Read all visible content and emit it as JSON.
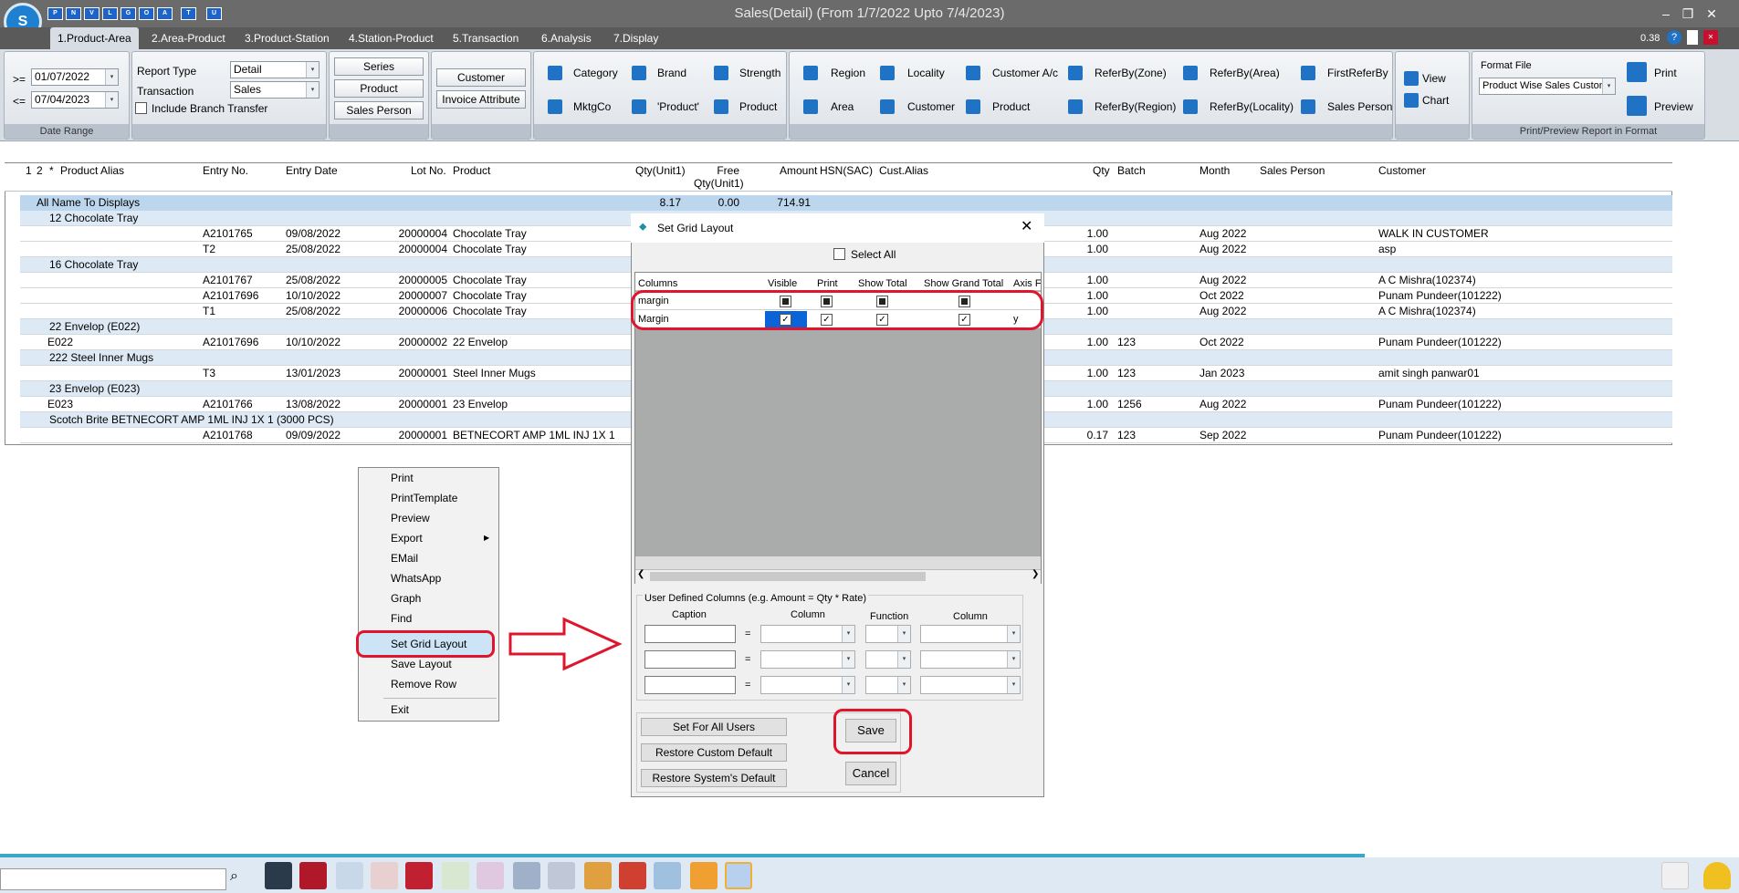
{
  "window": {
    "title": "Sales(Detail) (From 1/7/2022 Upto 7/4/2023)",
    "zoom": "0.38"
  },
  "quick_access": [
    "P",
    "N",
    "V",
    "L",
    "G",
    "O",
    "A",
    "T",
    "U"
  ],
  "tabs": [
    "1.Product-Area",
    "2.Area-Product",
    "3.Product-Station",
    "4.Station-Product",
    "5.Transaction",
    "6.Analysis",
    "7.Display"
  ],
  "date_range": {
    "from_op": ">=",
    "from": "01/07/2022",
    "to_op": "<=",
    "to": "07/04/2023",
    "group_label": "Date Range"
  },
  "report": {
    "type_label": "Report Type",
    "type_value": "Detail",
    "trans_label": "Transaction",
    "trans_value": "Sales",
    "branch_label": "Include Branch Transfer"
  },
  "buttons1": [
    "Series",
    "Product",
    "Sales Person"
  ],
  "buttons2": [
    "Customer",
    "Invoice Attribute"
  ],
  "filters1": [
    "Category",
    "Brand",
    "Strength",
    "MktgCo",
    "'Product'",
    "Product"
  ],
  "filters2": [
    "Region",
    "Locality",
    "Customer A/c",
    "ReferBy(Zone)",
    "ReferBy(Area)",
    "FirstReferBy",
    "Area",
    "Customer",
    "Product",
    "ReferBy(Region)",
    "ReferBy(Locality)",
    "Sales Person"
  ],
  "view": {
    "view": "View",
    "chart": "Chart"
  },
  "format": {
    "label": "Format File",
    "value": "Product Wise Sales Custom",
    "print": "Print",
    "preview": "Preview",
    "group_label": "Print/Preview Report in Format"
  },
  "grid": {
    "headers": [
      "1",
      "2",
      "*",
      "Product Alias",
      "Entry No.",
      "Entry Date",
      "Lot No.",
      "Product",
      "Qty(Unit1)",
      "Free Qty(Unit1)",
      "Amount",
      "HSN(SAC)",
      "Cust.Alias",
      "Qty",
      "Batch",
      "Month",
      "Sales Person",
      "Customer"
    ],
    "total_row": {
      "label": "All Name To Displays",
      "qty": "8.17",
      "free": "0.00",
      "amount": "714.91"
    },
    "rows": [
      {
        "kind": "group",
        "label": "12 Chocolate Tray"
      },
      {
        "kind": "data",
        "alias": "",
        "entry": "A2101765",
        "date": "09/08/2022",
        "lot": "20000004",
        "product": "Chocolate Tray",
        "qty": "1.00",
        "batch": "",
        "month": "Aug 2022",
        "customer": "WALK IN CUSTOMER"
      },
      {
        "kind": "data",
        "alias": "",
        "entry": "T2",
        "date": "25/08/2022",
        "lot": "20000004",
        "product": "Chocolate Tray",
        "qty": "1.00",
        "batch": "",
        "month": "Aug 2022",
        "customer": "asp"
      },
      {
        "kind": "group",
        "label": "16 Chocolate Tray"
      },
      {
        "kind": "data",
        "alias": "",
        "entry": "A2101767",
        "date": "25/08/2022",
        "lot": "20000005",
        "product": "Chocolate Tray",
        "qty": "1.00",
        "batch": "",
        "month": "Aug 2022",
        "customer": "A C Mishra(102374)"
      },
      {
        "kind": "data",
        "alias": "",
        "entry": "A21017696",
        "date": "10/10/2022",
        "lot": "20000007",
        "product": "Chocolate Tray",
        "qty": "1.00",
        "batch": "",
        "month": "Oct 2022",
        "customer": " Punam Pundeer(101222)"
      },
      {
        "kind": "data",
        "alias": "",
        "entry": "T1",
        "date": "25/08/2022",
        "lot": "20000006",
        "product": "Chocolate Tray",
        "qty": "1.00",
        "batch": "",
        "month": "Aug 2022",
        "customer": "A C Mishra(102374)"
      },
      {
        "kind": "group",
        "label": "22 Envelop (E022)"
      },
      {
        "kind": "data",
        "alias": "E022",
        "entry": "A21017696",
        "date": "10/10/2022",
        "lot": "20000002",
        "product": "22 Envelop",
        "qty": "1.00",
        "batch": "123",
        "month": "Oct 2022",
        "customer": " Punam Pundeer(101222)"
      },
      {
        "kind": "group",
        "label": "222 Steel Inner Mugs"
      },
      {
        "kind": "data",
        "alias": "",
        "entry": "T3",
        "date": "13/01/2023",
        "lot": "20000001",
        "product": "Steel Inner Mugs",
        "qty": "1.00",
        "batch": "123",
        "month": "Jan 2023",
        "customer": "amit singh panwar01"
      },
      {
        "kind": "group",
        "label": "23 Envelop (E023)"
      },
      {
        "kind": "data",
        "alias": "E023",
        "entry": "A2101766",
        "date": "13/08/2022",
        "lot": "20000001",
        "product": "23 Envelop",
        "qty": "1.00",
        "batch": "1256",
        "month": "Aug 2022",
        "customer": " Punam Pundeer(101222)"
      },
      {
        "kind": "group",
        "label": "Scotch Brite BETNECORT AMP 1ML INJ 1X 1 (3000 PCS)"
      },
      {
        "kind": "data",
        "alias": "",
        "entry": "A2101768",
        "date": "09/09/2022",
        "lot": "20000001",
        "product": "BETNECORT AMP 1ML INJ 1X 1",
        "qty": "0.17",
        "batch": "123",
        "month": "Sep 2022",
        "customer": " Punam Pundeer(101222)"
      }
    ]
  },
  "context_menu": [
    "Print",
    "PrintTemplate",
    "Preview",
    "Export",
    "EMail",
    "WhatsApp",
    "Graph",
    "Find",
    "Set Grid Layout",
    "Save Layout",
    "Remove Row",
    "Exit"
  ],
  "dialog": {
    "title": "Set Grid Layout",
    "select_all": "Select All",
    "columns": [
      "Columns",
      "Visible",
      "Print",
      "Show Total",
      "Show Grand Total",
      "Axis Fo"
    ],
    "rows": [
      {
        "name": "margin",
        "visible": "indeterminate",
        "print": "indeterminate",
        "total": "indeterminate",
        "grand": "indeterminate",
        "axis": ""
      },
      {
        "name": "Margin",
        "visible": "checked",
        "print": "checked",
        "total": "checked",
        "grand": "checked",
        "axis": "y"
      }
    ],
    "ud_title": "User Defined Columns (e.g. Amount = Qty * Rate)",
    "ud_headers": [
      "Caption",
      "Column",
      "Function",
      "Column"
    ],
    "equals": "=",
    "buttons": [
      "Set For All Users",
      "Restore Custom Default",
      "Restore System's Default"
    ],
    "save": "Save",
    "cancel": "Cancel"
  }
}
